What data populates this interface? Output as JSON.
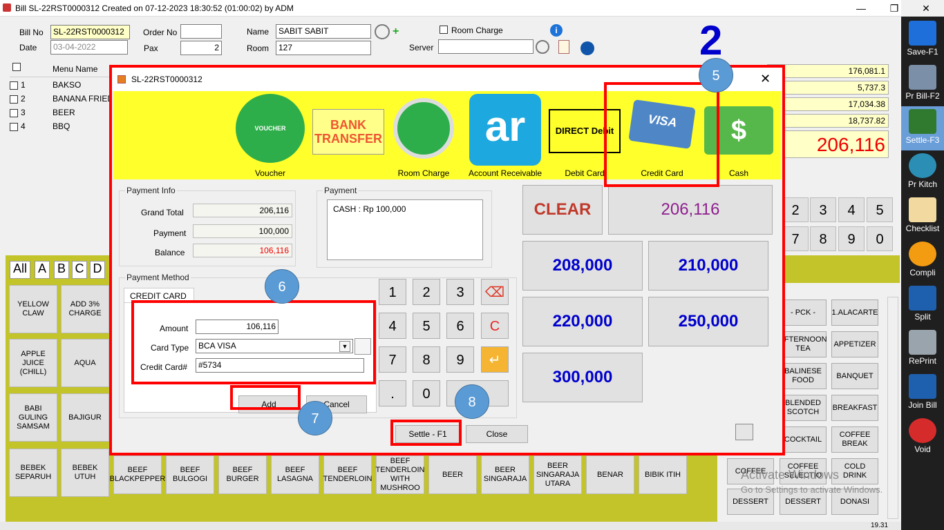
{
  "window": {
    "title": "Bill SL-22RST0000312 Created on 07-12-2023 18:30:52 (01:00:02) by ADM"
  },
  "header": {
    "bill_no_label": "Bill No",
    "bill_no": "SL-22RST0000312",
    "date_label": "Date",
    "date": "03-04-2022",
    "order_no_label": "Order No",
    "order_no": "",
    "pax_label": "Pax",
    "pax": "2",
    "name_label": "Name",
    "name": "SABIT SABIT",
    "room_label": "Room",
    "room": "127",
    "room_charge_label": "Room Charge",
    "server_label": "Server",
    "server": ""
  },
  "annotation_big_number": "2",
  "menu": {
    "column_header": "Menu Name",
    "items": [
      {
        "no": "1",
        "name": "BAKSO"
      },
      {
        "no": "2",
        "name": "BANANA FRIED"
      },
      {
        "no": "3",
        "name": "BEER"
      },
      {
        "no": "4",
        "name": "BBQ"
      }
    ]
  },
  "totals": [
    "176,081.1",
    "5,737.3",
    "17,034.38",
    "18,737.82"
  ],
  "grand_total_display": "206,116",
  "bg_numpad": [
    "2",
    "3",
    "4",
    "5",
    "7",
    "8",
    "9",
    "0"
  ],
  "category_letters": [
    "All",
    "A",
    "B",
    "C",
    "D"
  ],
  "left_tiles": [
    "YELLOW CLAW",
    "ADD 3% CHARGE",
    "APPLE JUICE (CHILL)",
    "AQUA",
    "BABI GULING SAMSAM",
    "BAJIGUR",
    "BEBEK SEPARUH",
    "BEBEK UTUH"
  ],
  "bottom_tiles": [
    "BEEF BLACKPEPPER",
    "BEEF BULGOGI",
    "BEEF BURGER",
    "BEEF LASAGNA",
    "BEEF TENDERLOIN",
    "BEEF TENDERLOIN WITH MUSHROO",
    "BEER",
    "BEER SINGARAJA",
    "BEER SINGARAJA UTARA",
    "BENAR",
    "BIBIK ITIH"
  ],
  "right_tiles": [
    [
      "- PCK -",
      "1.ALACARTE"
    ],
    [
      "AFTERNOON TEA",
      "APPETIZER"
    ],
    [
      "BALINESE FOOD",
      "BANQUET"
    ],
    [
      "BLENDED SCOTCH",
      "BREAKFAST"
    ],
    [
      "COCKTAIL",
      "COFFEE BREAK"
    ]
  ],
  "bottom_right_tiles": [
    [
      "COFFEE",
      "COFFEE SELECTIO",
      "COLD DRINK"
    ],
    [
      "DESSERT",
      "DESSERT",
      "DONASI"
    ]
  ],
  "watermark": {
    "line1": "Activate Windows",
    "line2": "Go to Settings to activate Windows."
  },
  "sidebar": [
    {
      "label": "Save-F1",
      "icon": "save-icon"
    },
    {
      "label": "Pr Bill-F2",
      "icon": "printer-icon"
    },
    {
      "label": "Settle-F3",
      "icon": "settle-icon"
    },
    {
      "label": "Pr Kitch",
      "icon": "kitchen-icon"
    },
    {
      "label": "Checklist",
      "icon": "checklist-icon"
    },
    {
      "label": "Compli",
      "icon": "free-icon"
    },
    {
      "label": "Split",
      "icon": "split-icon"
    },
    {
      "label": "RePrint",
      "icon": "reprint-icon"
    },
    {
      "label": "Join Bill",
      "icon": "join-icon"
    },
    {
      "label": "Void",
      "icon": "void-icon"
    }
  ],
  "dialog": {
    "title": "SL-22RST0000312",
    "payment_types": [
      {
        "label": "Voucher",
        "icon_text": "VOUCHER"
      },
      {
        "label": "",
        "icon_text": "BANK TRANSFER"
      },
      {
        "label": "Room Charge",
        "icon_text": ""
      },
      {
        "label": "Account Receivable",
        "icon_text": "ar"
      },
      {
        "label": "Debit Card",
        "icon_text": "DIRECT Debit"
      },
      {
        "label": "Credit Card",
        "icon_text": "VISA"
      },
      {
        "label": "Cash",
        "icon_text": "$"
      }
    ],
    "payment_info": {
      "title": "Payment Info",
      "grand_total_label": "Grand Total",
      "grand_total": "206,116",
      "payment_label": "Payment",
      "payment": "100,000",
      "balance_label": "Balance",
      "balance": "106,116"
    },
    "payment_list": {
      "title": "Payment",
      "entries": [
        "CASH :  Rp 100,000"
      ]
    },
    "method": {
      "title": "Payment Method",
      "tab": "CREDIT CARD",
      "amount_label": "Amount",
      "amount": "106,116",
      "card_type_label": "Card Type",
      "card_type": "BCA VISA",
      "card_no_label": "Credit Card#",
      "card_no": "#5734",
      "add_label": "Add",
      "cancel_label": "Cancel"
    },
    "keypad": [
      "1",
      "2",
      "3",
      "4",
      "5",
      "6",
      "7",
      "8",
      "9",
      ".",
      "0"
    ],
    "keypad_clear": "C",
    "quick": {
      "clear": "CLEAR",
      "exact": "206,116",
      "amounts": [
        "208,000",
        "210,000",
        "220,000",
        "250,000",
        "300,000"
      ]
    },
    "settle_label": "Settle - F1",
    "close_label": "Close"
  },
  "steps": [
    "5",
    "6",
    "7",
    "8"
  ],
  "clock": "19.31",
  "colors": {
    "highlight": "#ff0000",
    "step_circle": "#5b9bd5",
    "yellow_band": "#ffff2b",
    "quick_amount": "#0000cc",
    "clear": "#c0392b",
    "exact": "#8e1f8e"
  }
}
